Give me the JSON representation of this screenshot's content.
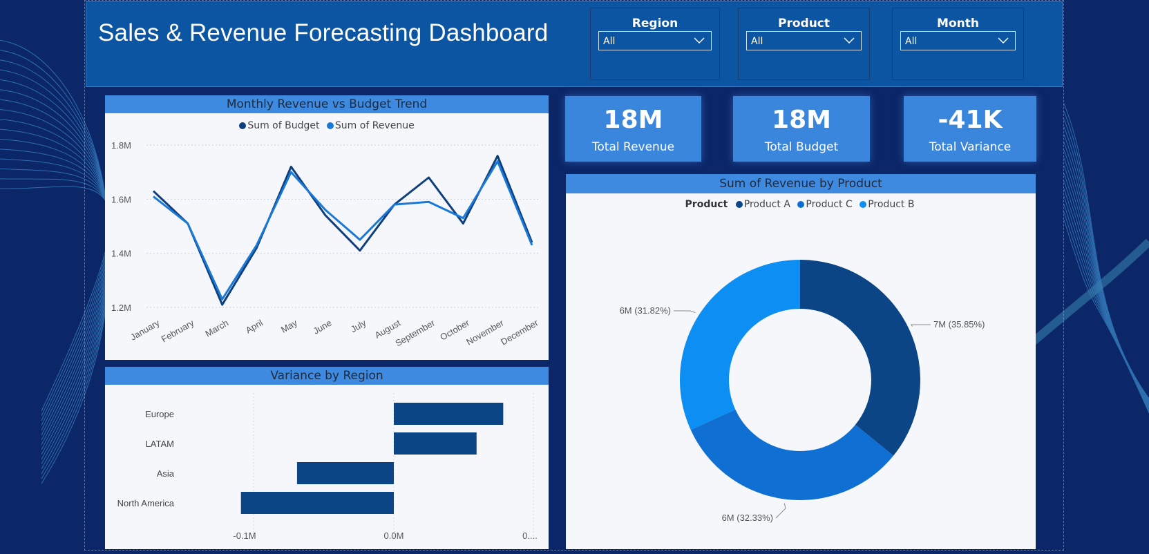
{
  "header": {
    "title": "Sales & Revenue Forecasting Dashboard"
  },
  "slicers": [
    {
      "label": "Region",
      "value": "All"
    },
    {
      "label": "Product",
      "value": "All"
    },
    {
      "label": "Month",
      "value": "All"
    }
  ],
  "kpis": [
    {
      "value": "18M",
      "label": "Total Revenue"
    },
    {
      "value": "18M",
      "label": "Total Budget"
    },
    {
      "value": "-41K",
      "label": "Total Variance"
    }
  ],
  "colors": {
    "budget": "#0e3f7c",
    "revenue": "#1a78d6",
    "product_a": "#0b4585",
    "product_c": "#0f6fd2",
    "product_b": "#0c8ef2",
    "bar": "#0b4585",
    "panel_header": "#3e8ae0"
  },
  "line_chart": {
    "title": "Monthly Revenue vs Budget Trend",
    "legend": [
      "Sum of Budget",
      "Sum of Revenue"
    ],
    "chart_data": {
      "type": "line",
      "categories": [
        "January",
        "February",
        "March",
        "April",
        "May",
        "June",
        "July",
        "August",
        "September",
        "October",
        "November",
        "December"
      ],
      "series": [
        {
          "name": "Sum of Budget",
          "values": [
            1.63,
            1.51,
            1.21,
            1.42,
            1.72,
            1.54,
            1.41,
            1.58,
            1.68,
            1.51,
            1.76,
            1.44
          ]
        },
        {
          "name": "Sum of Revenue",
          "values": [
            1.61,
            1.51,
            1.23,
            1.43,
            1.7,
            1.56,
            1.45,
            1.58,
            1.59,
            1.53,
            1.74,
            1.43
          ]
        }
      ],
      "ylim": [
        1.2,
        1.8
      ],
      "yticks": [
        "1.2M",
        "1.4M",
        "1.6M",
        "1.8M"
      ],
      "ytick_values": [
        1.2,
        1.4,
        1.6,
        1.8
      ],
      "unit": "M"
    }
  },
  "bar_chart": {
    "title": "Variance by Region",
    "chart_data": {
      "type": "bar",
      "orientation": "horizontal",
      "categories": [
        "Europe",
        "LATAM",
        "Asia",
        "North America"
      ],
      "values": [
        0.078,
        0.059,
        -0.069,
        -0.109
      ],
      "xlim": [
        -0.1,
        0.1
      ],
      "xticks": [
        "-0.1M",
        "0.0M",
        "0...."
      ],
      "xtick_values": [
        -0.1,
        0.0,
        0.1
      ]
    }
  },
  "donut_chart": {
    "title": "Sum of Revenue by Product",
    "legend_title": "Product",
    "chart_data": {
      "type": "pie",
      "categories": [
        "Product A",
        "Product C",
        "Product B"
      ],
      "values": [
        35.85,
        32.33,
        31.82
      ],
      "labels": [
        "7M (35.85%)",
        "6M (32.33%)",
        "6M (31.82%)"
      ]
    }
  }
}
